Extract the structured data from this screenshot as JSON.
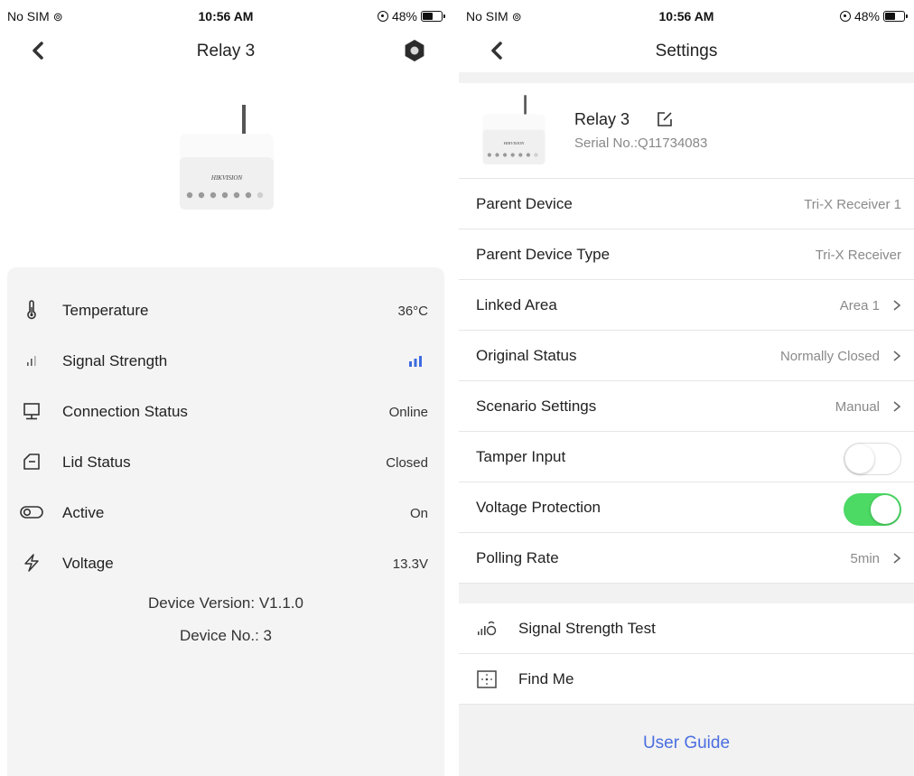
{
  "status_bar": {
    "carrier": "No SIM",
    "time": "10:56 AM",
    "battery_pct": "48%",
    "battery_level": 0.48
  },
  "left": {
    "title": "Relay 3",
    "device_brand": "HIKVISION",
    "rows": [
      {
        "icon": "thermometer-icon",
        "label": "Temperature",
        "value": "36°C"
      },
      {
        "icon": "signal-bars-icon",
        "label": "Signal Strength",
        "value": "",
        "signal_bars": 3,
        "signal_color": "#3d6be0"
      },
      {
        "icon": "monitor-icon",
        "label": "Connection Status",
        "value": "Online"
      },
      {
        "icon": "lid-icon",
        "label": "Lid Status",
        "value": "Closed"
      },
      {
        "icon": "toggle-icon",
        "label": "Active",
        "value": "On"
      },
      {
        "icon": "lightning-icon",
        "label": "Voltage",
        "value": "13.3V"
      }
    ],
    "device_version": "Device Version: V1.1.0",
    "device_no": "Device No.: 3"
  },
  "right": {
    "title": "Settings",
    "device": {
      "name": "Relay 3",
      "serial": "Serial No.:Q11734083",
      "brand": "HIKVISION"
    },
    "rows": [
      {
        "label": "Parent Device",
        "value": "Tri-X Receiver 1",
        "type": "text"
      },
      {
        "label": "Parent Device Type",
        "value": "Tri-X Receiver",
        "type": "text"
      },
      {
        "label": "Linked Area",
        "value": "Area 1",
        "type": "nav"
      },
      {
        "label": "Original Status",
        "value": "Normally Closed",
        "type": "nav"
      },
      {
        "label": "Scenario Settings",
        "value": "Manual",
        "type": "nav"
      },
      {
        "label": "Tamper Input",
        "value": "",
        "type": "toggle",
        "on": false
      },
      {
        "label": "Voltage Protection",
        "value": "",
        "type": "toggle",
        "on": true
      },
      {
        "label": "Polling Rate",
        "value": "5min",
        "type": "nav"
      }
    ],
    "tools": [
      {
        "icon": "signal-test-icon",
        "label": "Signal Strength Test"
      },
      {
        "icon": "find-me-icon",
        "label": "Find Me"
      }
    ],
    "user_guide": "User Guide",
    "accent_color": "#4a6ee0",
    "toggle_on_color": "#4cd964"
  }
}
